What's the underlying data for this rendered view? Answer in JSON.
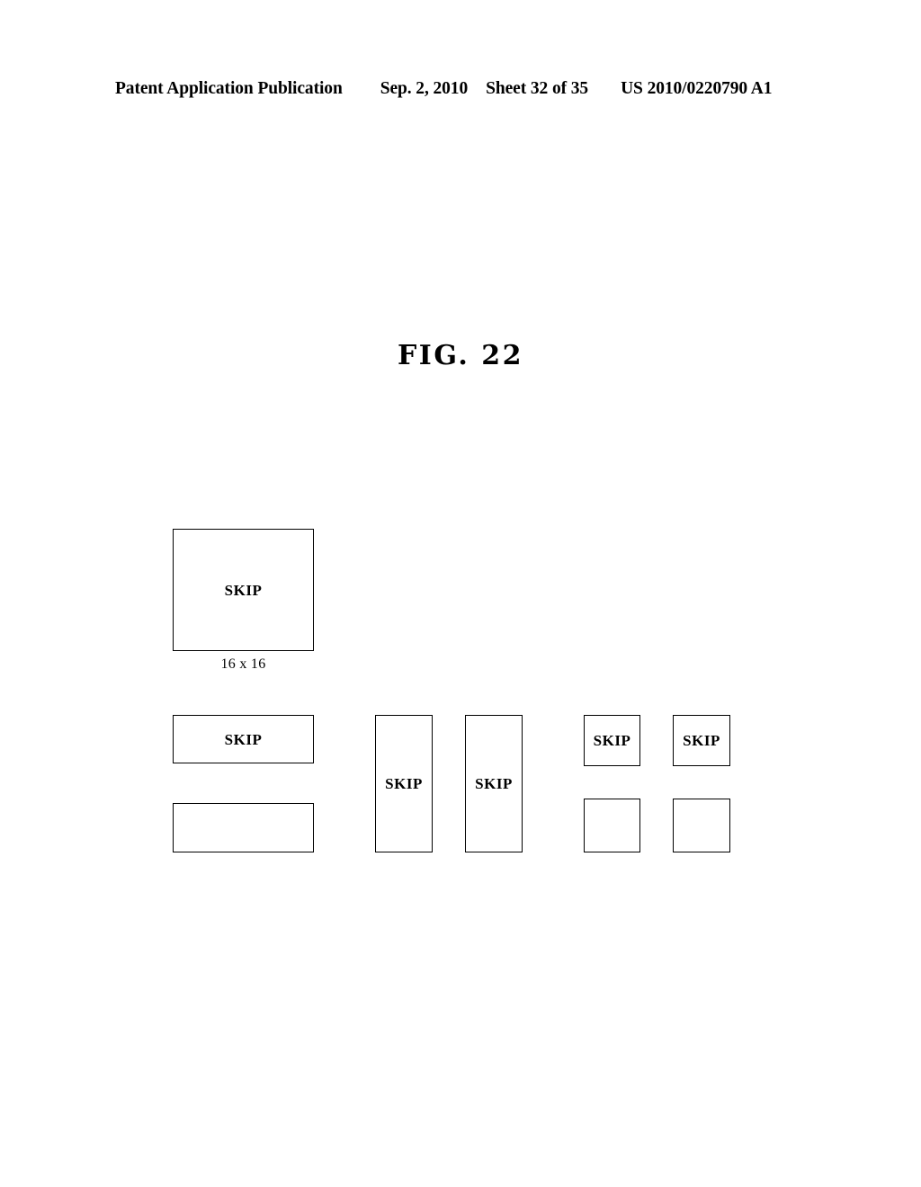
{
  "header": {
    "publication": "Patent Application Publication",
    "date": "Sep. 2, 2010",
    "sheet": "Sheet 32 of 35",
    "document_number": "US 2010/0220790 A1"
  },
  "figure": {
    "title": "FIG. 22",
    "caption_16x16": "16 x 16"
  },
  "blocks": {
    "mb16x16": {
      "label": "SKIP"
    },
    "mb16x8_top": {
      "label": "SKIP"
    },
    "mb16x8_bottom": {
      "label": ""
    },
    "mb8x16_left": {
      "label": "SKIP"
    },
    "mb8x16_right": {
      "label": "SKIP"
    },
    "mb8x8_top_left": {
      "label": "SKIP"
    },
    "mb8x8_top_right": {
      "label": "SKIP"
    },
    "mb8x8_bottom_left": {
      "label": ""
    },
    "mb8x8_bottom_right": {
      "label": ""
    }
  },
  "colors": {
    "page_background": "#ffffff",
    "ink": "#000000",
    "block_border": "#000000",
    "block_fill": "#ffffff"
  }
}
